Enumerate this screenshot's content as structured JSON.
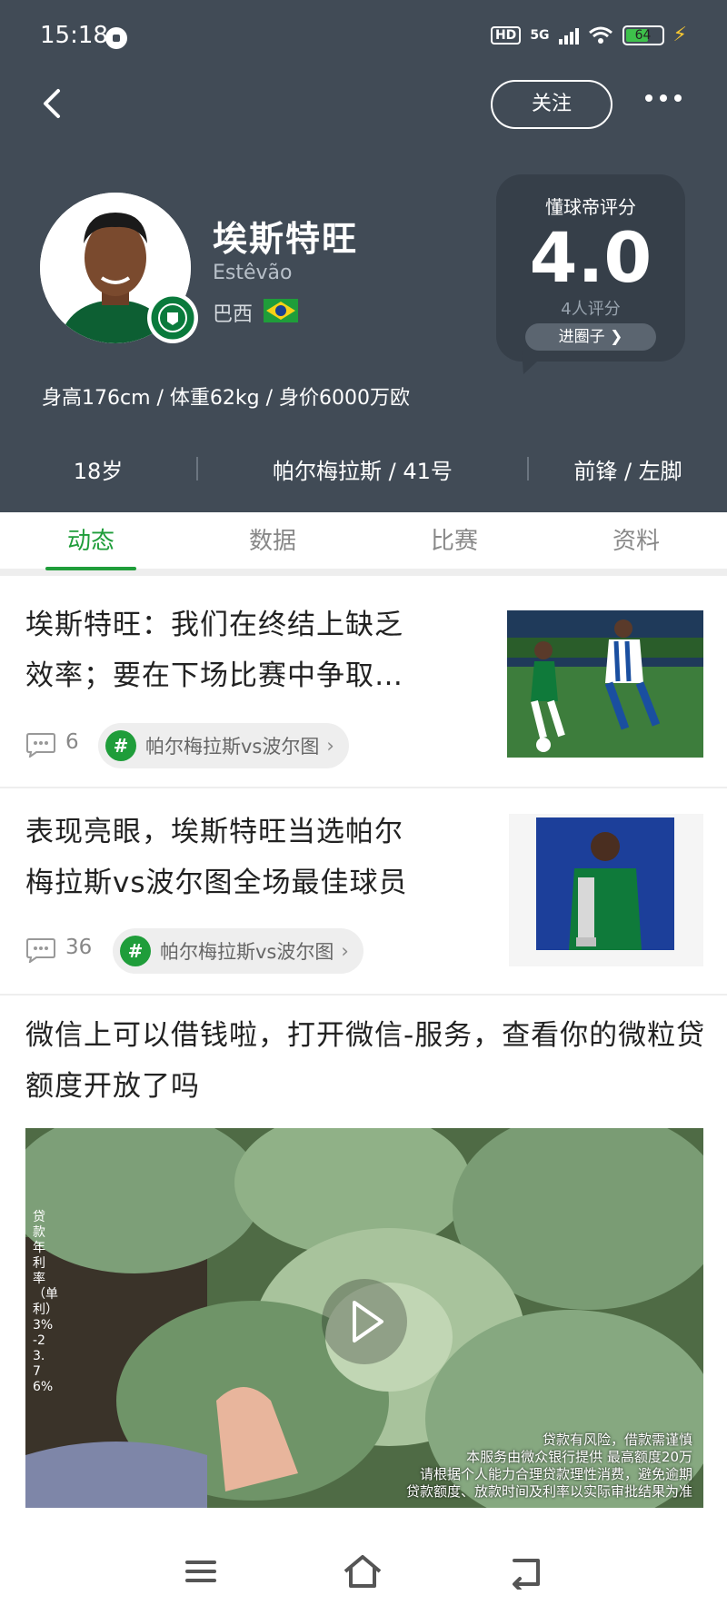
{
  "status_bar": {
    "time": "15:18",
    "hd": "HD",
    "network": "5G",
    "battery": "64",
    "battery_level": 0.64,
    "colors": {
      "battery_fill": "#3ec14b",
      "charging": "#f7c731"
    }
  },
  "header": {
    "follow_label": "关注",
    "player_name": "埃斯特旺",
    "player_latin": "Estêvão",
    "country": "巴西",
    "physical": "身高176cm / 体重62kg / 身价6000万欧",
    "age": "18岁",
    "club_number": "帕尔梅拉斯 / 41号",
    "position_foot": "前锋 / 左脚",
    "rating": {
      "title": "懂球帝评分",
      "score": "4.0",
      "count": "4人评分",
      "button": "进圈子"
    },
    "colors": {
      "background": "#414b56",
      "card": "#363f49"
    }
  },
  "tabs": [
    {
      "label": "动态",
      "active": true
    },
    {
      "label": "数据",
      "active": false
    },
    {
      "label": "比赛",
      "active": false
    },
    {
      "label": "资料",
      "active": false
    }
  ],
  "accent_color": "#1f9d3a",
  "articles": [
    {
      "title_line1": "埃斯特旺：我们在终结上缺乏",
      "title_line2": "效率；要在下场比赛中争取…",
      "comments": "6",
      "topic": "帕尔梅拉斯vs波尔图"
    },
    {
      "title_line1": "表现亮眼，埃斯特旺当选帕尔",
      "title_line2": "梅拉斯vs波尔图全场最佳球员",
      "comments": "36",
      "topic": "帕尔梅拉斯vs波尔图"
    }
  ],
  "ad": {
    "title": "微信上可以借钱啦，打开微信-服务，查看你的微粒贷额度开放了吗",
    "side_text": "贷款年利率（单利）3%-23.76%",
    "disclaimer_line1": "贷款有风险，借款需谨慎",
    "disclaimer_line2": "本服务由微众银行提供 最高额度20万",
    "disclaimer_line3": "请根据个人能力合理贷款理性消费，避免逾期",
    "disclaimer_line4": "贷款额度、放款时间及利率以实际审批结果为准"
  },
  "icons": {
    "back": "back-arrow-icon",
    "more": "more-dots-icon",
    "comment": "comment-bubble-icon",
    "topic": "hash-icon",
    "play": "play-icon",
    "nav_menu": "menu-icon",
    "nav_home": "home-icon",
    "nav_back": "return-icon"
  }
}
